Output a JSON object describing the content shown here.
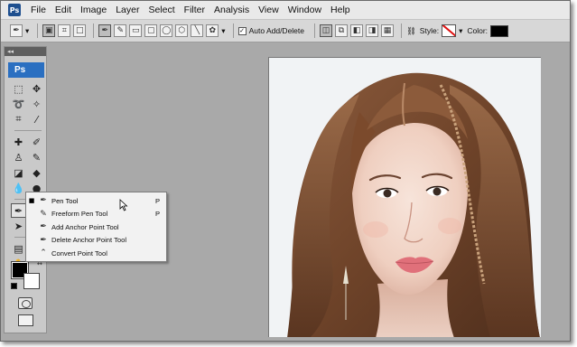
{
  "menubar": {
    "app_logo": "Ps",
    "items": [
      "File",
      "Edit",
      "Image",
      "Layer",
      "Select",
      "Filter",
      "Analysis",
      "View",
      "Window",
      "Help"
    ]
  },
  "options_bar": {
    "auto_add_delete_label": "Auto Add/Delete",
    "auto_add_delete_checked": true,
    "style_label": "Style:",
    "color_label": "Color:",
    "color_value": "#000000"
  },
  "tools_panel": {
    "badge": "Ps",
    "collapse_glyph": "◂◂",
    "foreground_color": "#000000",
    "background_color": "#ffffff"
  },
  "pen_flyout": {
    "items": [
      {
        "label": "Pen Tool",
        "shortcut": "P",
        "selected": true,
        "icon": "pen-icon"
      },
      {
        "label": "Freeform Pen Tool",
        "shortcut": "P",
        "selected": false,
        "icon": "freeform-pen-icon"
      },
      {
        "label": "Add Anchor Point Tool",
        "shortcut": "",
        "selected": false,
        "icon": "add-anchor-icon"
      },
      {
        "label": "Delete Anchor Point Tool",
        "shortcut": "",
        "selected": false,
        "icon": "delete-anchor-icon"
      },
      {
        "label": "Convert Point Tool",
        "shortcut": "",
        "selected": false,
        "icon": "convert-point-icon"
      }
    ]
  },
  "document": {
    "content": "portrait-photo"
  }
}
